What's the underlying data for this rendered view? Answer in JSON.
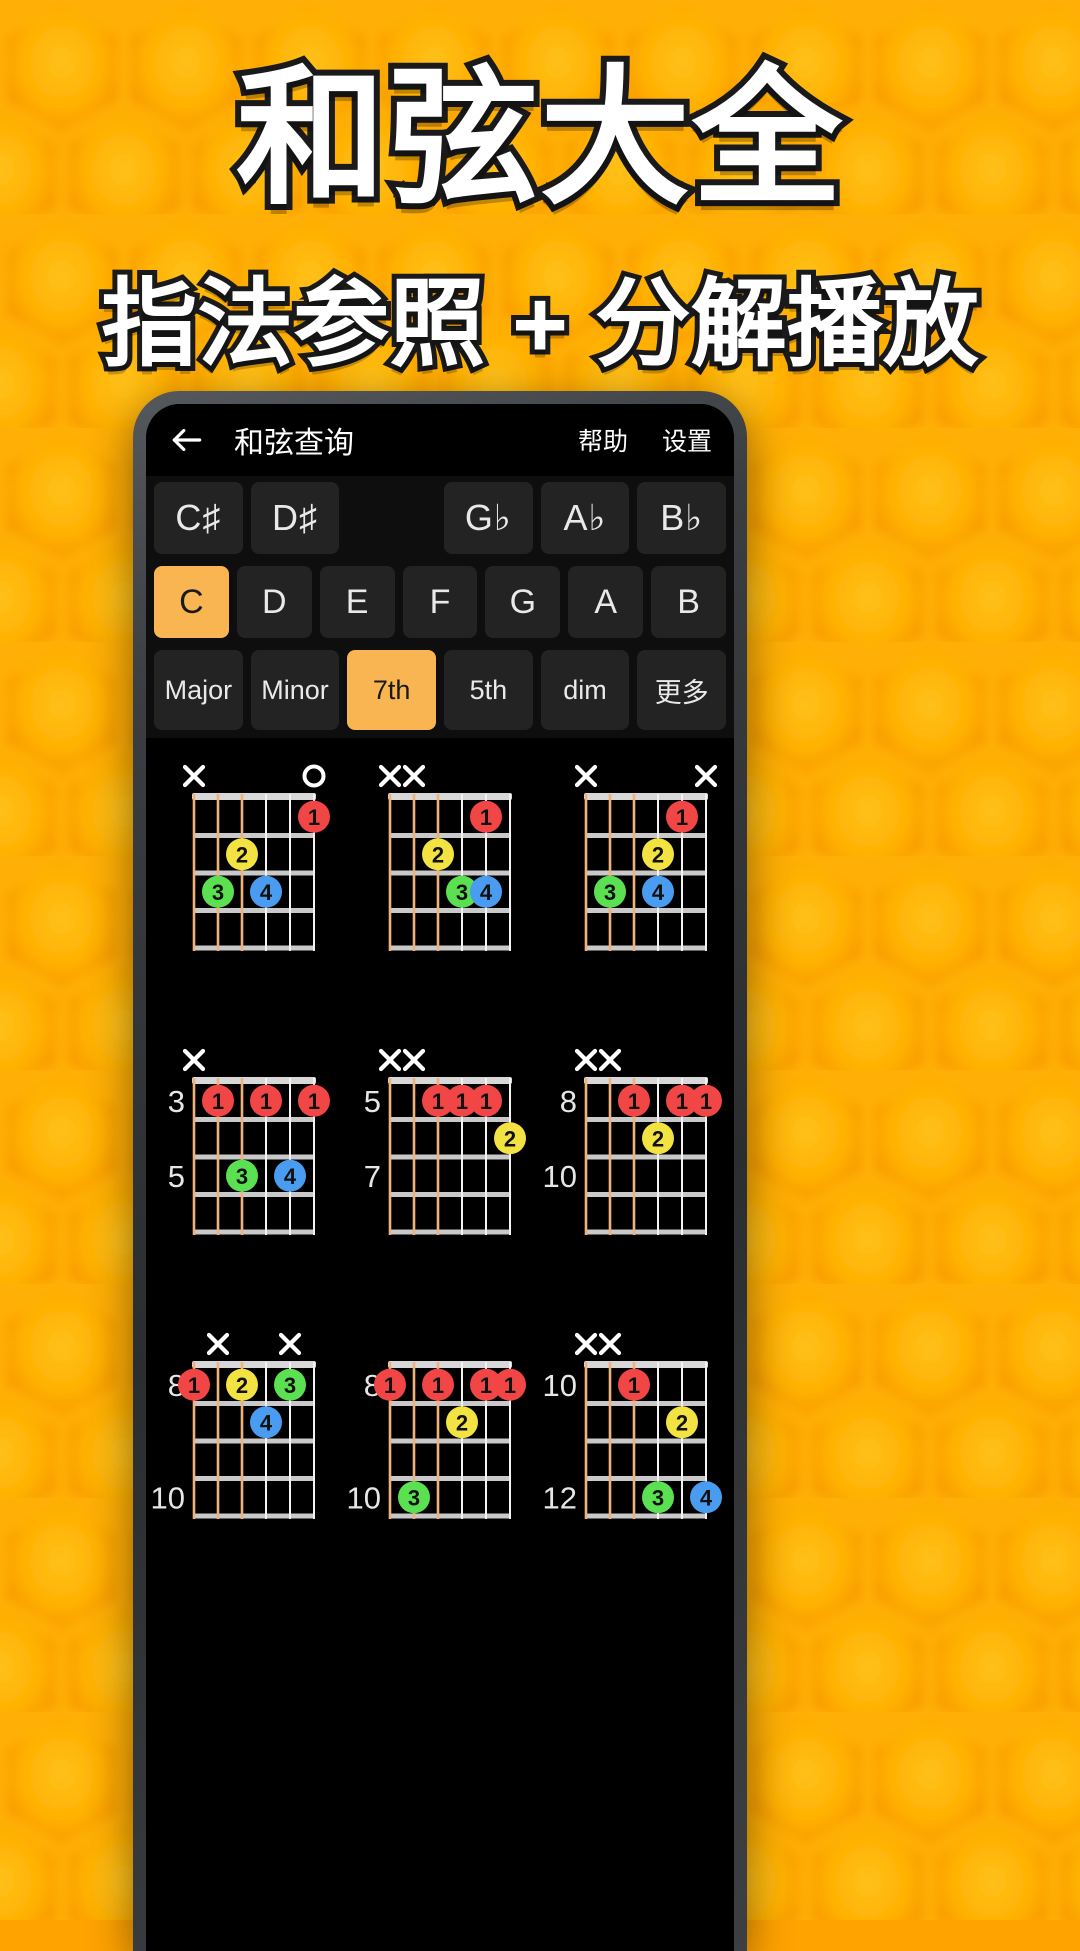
{
  "promo": {
    "title": "和弦大全",
    "subtitle": "指法参照 + 分解播放"
  },
  "colors": {
    "bg_orange": "#FFA800",
    "accent": "#F8B552",
    "finger1": "#F24646",
    "finger2": "#F2E242",
    "finger3": "#5BE052",
    "finger4": "#4A9CF0",
    "screen_bg": "#000000",
    "key_bg": "#232323"
  },
  "appbar": {
    "back_icon": "arrow-left-icon",
    "title": "和弦查询",
    "help_label": "帮助",
    "settings_label": "设置"
  },
  "accidental_row": [
    {
      "label": "C♯",
      "type": "key",
      "selected": false
    },
    {
      "label": "D♯",
      "type": "key",
      "selected": false
    },
    {
      "label": "",
      "type": "ghost",
      "selected": false
    },
    {
      "label": "G♭",
      "type": "key",
      "selected": false
    },
    {
      "label": "A♭",
      "type": "key",
      "selected": false
    },
    {
      "label": "B♭",
      "type": "key",
      "selected": false
    }
  ],
  "root_row": [
    {
      "label": "C",
      "selected": true
    },
    {
      "label": "D",
      "selected": false
    },
    {
      "label": "E",
      "selected": false
    },
    {
      "label": "F",
      "selected": false
    },
    {
      "label": "G",
      "selected": false
    },
    {
      "label": "A",
      "selected": false
    },
    {
      "label": "B",
      "selected": false
    }
  ],
  "quality_row": [
    {
      "label": "Major",
      "selected": false
    },
    {
      "label": "Minor",
      "selected": false
    },
    {
      "label": "7th",
      "selected": true
    },
    {
      "label": "5th",
      "selected": false
    },
    {
      "label": "dim",
      "selected": false
    },
    {
      "label": "更多",
      "selected": false
    }
  ],
  "chord_diagrams": [
    {
      "position": "r1c1",
      "base_fret_labels": [],
      "open_marks": [
        "x",
        "",
        "",
        "",
        "",
        "o"
      ],
      "dots": [
        {
          "string": 5,
          "fret": 1,
          "finger": "1",
          "color": "#F24646"
        },
        {
          "string": 2,
          "fret": 2,
          "finger": "2",
          "color": "#F2E242"
        },
        {
          "string": 1,
          "fret": 3,
          "finger": "3",
          "color": "#5BE052"
        },
        {
          "string": 3,
          "fret": 3,
          "finger": "4",
          "color": "#4A9CF0"
        }
      ]
    },
    {
      "position": "r1c2",
      "base_fret_labels": [],
      "open_marks": [
        "x",
        "x",
        "",
        "",
        "",
        ""
      ],
      "dots": [
        {
          "string": 4,
          "fret": 1,
          "finger": "1",
          "color": "#F24646"
        },
        {
          "string": 2,
          "fret": 2,
          "finger": "2",
          "color": "#F2E242"
        },
        {
          "string": 3,
          "fret": 3,
          "finger": "3",
          "color": "#5BE052"
        },
        {
          "string": 4,
          "fret": 3,
          "finger": "4",
          "color": "#4A9CF0"
        }
      ]
    },
    {
      "position": "r1c3",
      "base_fret_labels": [],
      "open_marks": [
        "x",
        "",
        "",
        "",
        "",
        "x"
      ],
      "dots": [
        {
          "string": 4,
          "fret": 1,
          "finger": "1",
          "color": "#F24646"
        },
        {
          "string": 3,
          "fret": 2,
          "finger": "2",
          "color": "#F2E242"
        },
        {
          "string": 1,
          "fret": 3,
          "finger": "3",
          "color": "#5BE052"
        },
        {
          "string": 3,
          "fret": 3,
          "finger": "4",
          "color": "#4A9CF0"
        }
      ]
    },
    {
      "position": "r2c1",
      "base_fret_labels": [
        {
          "text": "3",
          "fret": 1
        },
        {
          "text": "5",
          "fret": 3
        }
      ],
      "open_marks": [
        "x",
        "",
        "",
        "",
        "",
        ""
      ],
      "dots": [
        {
          "string": 1,
          "fret": 1,
          "finger": "1",
          "color": "#F24646"
        },
        {
          "string": 3,
          "fret": 1,
          "finger": "1",
          "color": "#F24646"
        },
        {
          "string": 5,
          "fret": 1,
          "finger": "1",
          "color": "#F24646"
        },
        {
          "string": 2,
          "fret": 3,
          "finger": "3",
          "color": "#5BE052"
        },
        {
          "string": 4,
          "fret": 3,
          "finger": "4",
          "color": "#4A9CF0"
        }
      ]
    },
    {
      "position": "r2c2",
      "base_fret_labels": [
        {
          "text": "5",
          "fret": 1
        },
        {
          "text": "7",
          "fret": 3
        }
      ],
      "open_marks": [
        "x",
        "x",
        "",
        "",
        "",
        ""
      ],
      "dots": [
        {
          "string": 2,
          "fret": 1,
          "finger": "1",
          "color": "#F24646"
        },
        {
          "string": 3,
          "fret": 1,
          "finger": "1",
          "color": "#F24646"
        },
        {
          "string": 4,
          "fret": 1,
          "finger": "1",
          "color": "#F24646"
        },
        {
          "string": 5,
          "fret": 2,
          "finger": "2",
          "color": "#F2E242"
        }
      ]
    },
    {
      "position": "r2c3",
      "base_fret_labels": [
        {
          "text": "8",
          "fret": 1
        },
        {
          "text": "10",
          "fret": 3
        }
      ],
      "open_marks": [
        "x",
        "x",
        "",
        "",
        "",
        ""
      ],
      "dots": [
        {
          "string": 2,
          "fret": 1,
          "finger": "1",
          "color": "#F24646"
        },
        {
          "string": 4,
          "fret": 1,
          "finger": "1",
          "color": "#F24646"
        },
        {
          "string": 5,
          "fret": 1,
          "finger": "1",
          "color": "#F24646"
        },
        {
          "string": 3,
          "fret": 2,
          "finger": "2",
          "color": "#F2E242"
        }
      ]
    },
    {
      "position": "r3c1",
      "base_fret_labels": [
        {
          "text": "8",
          "fret": 1
        },
        {
          "text": "10",
          "fret": 4
        }
      ],
      "open_marks": [
        "",
        "x",
        "",
        "",
        "x",
        ""
      ],
      "dots": [
        {
          "string": 0,
          "fret": 1,
          "finger": "1",
          "color": "#F24646"
        },
        {
          "string": 2,
          "fret": 1,
          "finger": "2",
          "color": "#F2E242"
        },
        {
          "string": 4,
          "fret": 1,
          "finger": "3",
          "color": "#5BE052"
        },
        {
          "string": 3,
          "fret": 2,
          "finger": "4",
          "color": "#4A9CF0"
        }
      ]
    },
    {
      "position": "r3c2",
      "base_fret_labels": [
        {
          "text": "8",
          "fret": 1
        },
        {
          "text": "10",
          "fret": 4
        }
      ],
      "open_marks": [
        "",
        "",
        "",
        "",
        "",
        ""
      ],
      "dots": [
        {
          "string": 0,
          "fret": 1,
          "finger": "1",
          "color": "#F24646"
        },
        {
          "string": 2,
          "fret": 1,
          "finger": "1",
          "color": "#F24646"
        },
        {
          "string": 4,
          "fret": 1,
          "finger": "1",
          "color": "#F24646"
        },
        {
          "string": 5,
          "fret": 1,
          "finger": "1",
          "color": "#F24646"
        },
        {
          "string": 3,
          "fret": 2,
          "finger": "2",
          "color": "#F2E242"
        },
        {
          "string": 1,
          "fret": 4,
          "finger": "3",
          "color": "#5BE052"
        }
      ]
    },
    {
      "position": "r3c3",
      "base_fret_labels": [
        {
          "text": "10",
          "fret": 1
        },
        {
          "text": "12",
          "fret": 4
        }
      ],
      "open_marks": [
        "x",
        "x",
        "",
        "",
        "",
        ""
      ],
      "dots": [
        {
          "string": 2,
          "fret": 1,
          "finger": "1",
          "color": "#F24646"
        },
        {
          "string": 4,
          "fret": 2,
          "finger": "2",
          "color": "#F2E242"
        },
        {
          "string": 3,
          "fret": 4,
          "finger": "3",
          "color": "#5BE052"
        },
        {
          "string": 5,
          "fret": 4,
          "finger": "4",
          "color": "#4A9CF0"
        }
      ]
    }
  ]
}
